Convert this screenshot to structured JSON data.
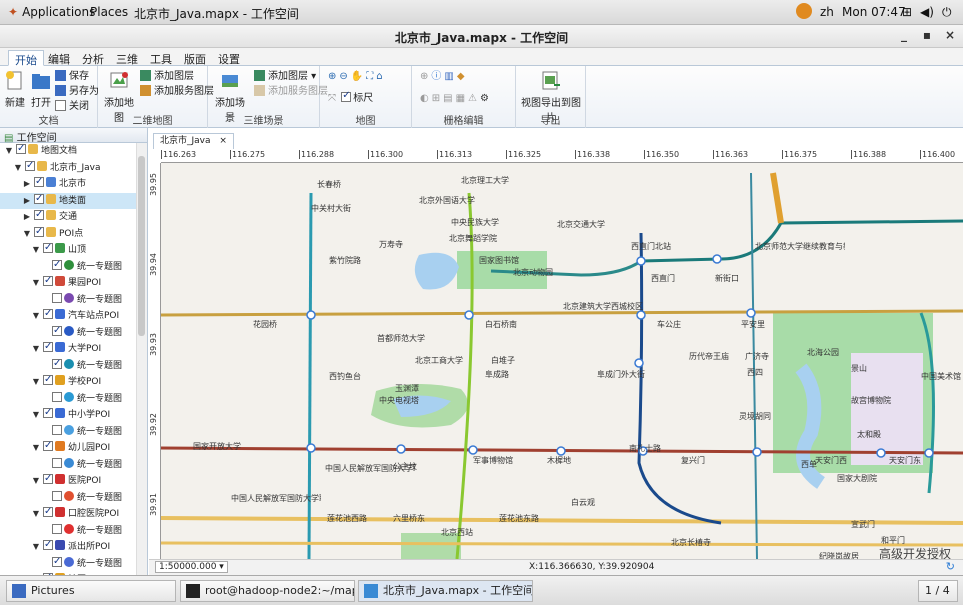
{
  "topbar": {
    "applications": "Applications",
    "places": "Places",
    "window_title": "北京市_Java.mapx - 工作空间",
    "lang": "zh",
    "clock": "Mon 07:47"
  },
  "window": {
    "title": "北京市_Java.mapx - 工作空间",
    "minimize": "_",
    "maximize": "▪",
    "close": "×"
  },
  "ribbon_tabs": [
    "开始",
    "编辑",
    "分析",
    "三维",
    "工具",
    "版面",
    "设置"
  ],
  "ribbon": {
    "doc": {
      "new": "新建",
      "open": "打开",
      "save": "保存",
      "save_as": "另存为",
      "close": "关闭",
      "label": "文档"
    },
    "map2d": {
      "add_map": "添加地图",
      "add_layer": "添加图层",
      "add_service_layer": "添加服务图层",
      "label": "二维地图"
    },
    "scene3d": {
      "add_scene": "添加场景",
      "add_layer": "添加图层",
      "add_service_layer": "添加服务图层",
      "label": "三维场景"
    },
    "map": {
      "ruler": "标尺",
      "label": "地图"
    },
    "grid": {
      "label": "栅格编辑"
    },
    "export": {
      "export_image": "视图导出到图片",
      "label": "导出"
    }
  },
  "left_panel": {
    "title": "工作空间",
    "tree": [
      {
        "label": "地图文档",
        "level": 0,
        "check": true
      },
      {
        "label": "北京市_Java",
        "level": 1,
        "check": true
      },
      {
        "label": "北京市",
        "level": 2,
        "check": true,
        "collapsed": true,
        "color": "#4a7fd4"
      },
      {
        "label": "地类面",
        "level": 2,
        "check": true,
        "collapsed": true,
        "selected": true,
        "color": "#e8b84a"
      },
      {
        "label": "交通",
        "level": 2,
        "check": true,
        "collapsed": true,
        "color": "#e8b84a"
      },
      {
        "label": "POI点",
        "level": 2,
        "check": true,
        "color": "#e8b84a"
      },
      {
        "label": "山顶",
        "level": 3,
        "check": true,
        "color": "#3c9a4a"
      },
      {
        "label": "统一专题图",
        "level": 4,
        "check": true,
        "color": "#2f8f3c"
      },
      {
        "label": "果园POI",
        "level": 3,
        "check": true,
        "color": "#d04a3a"
      },
      {
        "label": "统一专题图",
        "level": 4,
        "check": false,
        "color": "#7a4ab0"
      },
      {
        "label": "汽车站点POI",
        "level": 3,
        "check": true,
        "color": "#3a6ad4"
      },
      {
        "label": "统一专题图",
        "level": 4,
        "check": true,
        "color": "#2a5ac4"
      },
      {
        "label": "大学POI",
        "level": 3,
        "check": true,
        "color": "#3a6ad4"
      },
      {
        "label": "统一专题图",
        "level": 4,
        "check": true,
        "color": "#1a8fb0"
      },
      {
        "label": "学校POI",
        "level": 3,
        "check": true,
        "color": "#e0a020"
      },
      {
        "label": "统一专题图",
        "level": 4,
        "check": false,
        "color": "#2a9ad4"
      },
      {
        "label": "中小学POI",
        "level": 3,
        "check": true,
        "color": "#3a6ad4"
      },
      {
        "label": "统一专题图",
        "level": 4,
        "check": false,
        "color": "#4aa0e0"
      },
      {
        "label": "幼儿园POI",
        "level": 3,
        "check": true,
        "color": "#e07a20"
      },
      {
        "label": "统一专题图",
        "level": 4,
        "check": false,
        "color": "#3a8ad4"
      },
      {
        "label": "医院POI",
        "level": 3,
        "check": true,
        "color": "#d03030"
      },
      {
        "label": "统一专题图",
        "level": 4,
        "check": false,
        "color": "#e05030"
      },
      {
        "label": "口腔医院POI",
        "level": 3,
        "check": true,
        "color": "#d03030"
      },
      {
        "label": "统一专题图",
        "level": 4,
        "check": false,
        "color": "#e03030"
      },
      {
        "label": "派出所POI",
        "level": 3,
        "check": true,
        "color": "#3a4ab0"
      },
      {
        "label": "统一专题图",
        "level": 4,
        "check": true,
        "color": "#4a6ad4"
      },
      {
        "label": "社区POI",
        "level": 3,
        "check": true,
        "color": "#e0a020"
      }
    ]
  },
  "map_tab": {
    "title": "北京市_Java",
    "close": "×"
  },
  "ruler_x": [
    "116.263",
    "116.275",
    "116.288",
    "116.300",
    "116.313",
    "116.325",
    "116.338",
    "116.350",
    "116.363",
    "116.375",
    "116.388",
    "116.400"
  ],
  "ruler_y": [
    "39.95",
    "39.94",
    "39.93",
    "39.92",
    "39.91"
  ],
  "map_labels": [
    "北京理工大学",
    "中关村大街",
    "长春桥",
    "北京外国语大学",
    "中央民族大学",
    "北京舞蹈学院",
    "北京交通大学",
    "西直门北站",
    "万寿寺",
    "国家图书馆",
    "北京动物园",
    "紫竹院路",
    "北京建筑大学西城校区",
    "西直门",
    "新街口",
    "北京师范大学继续教育与教师培训学院",
    "首都师范大学",
    "花园桥",
    "白石桥南",
    "车公庄",
    "平安里",
    "北京工商大学",
    "白堆子",
    "阜成路",
    "阜成门外大街",
    "历代帝王庙",
    "广济寺",
    "西四",
    "北海公园",
    "景山",
    "中国美术馆",
    "西钓鱼台",
    "中央电视塔",
    "灵境胡同",
    "故宫博物院",
    "太和殿",
    "国家开放大学",
    "公主坟",
    "军事博物馆",
    "木樨地",
    "南礼士路",
    "复兴门",
    "西单",
    "天安门西",
    "天安门东",
    "国家大剧院",
    "中国人民解放军国防大学联合勤务学院",
    "中国人民解放军国防大学联合勤务学院",
    "莲花池西路",
    "六里桥东",
    "莲花池东路",
    "北京西站",
    "白云观",
    "北京长椿寺",
    "宣武门",
    "和平门",
    "纪晓岚故居",
    "玉渊潭"
  ],
  "status": {
    "scale": "1:50000.000",
    "coords": "X:116.366630, Y:39.920904"
  },
  "watermark": "高级开发授权",
  "taskbar": {
    "items": [
      "Pictures",
      "root@hadoop-node2:~/mapgis10/pr...",
      "北京市_Java.mapx - 工作空间"
    ],
    "pager": "1 / 4"
  }
}
